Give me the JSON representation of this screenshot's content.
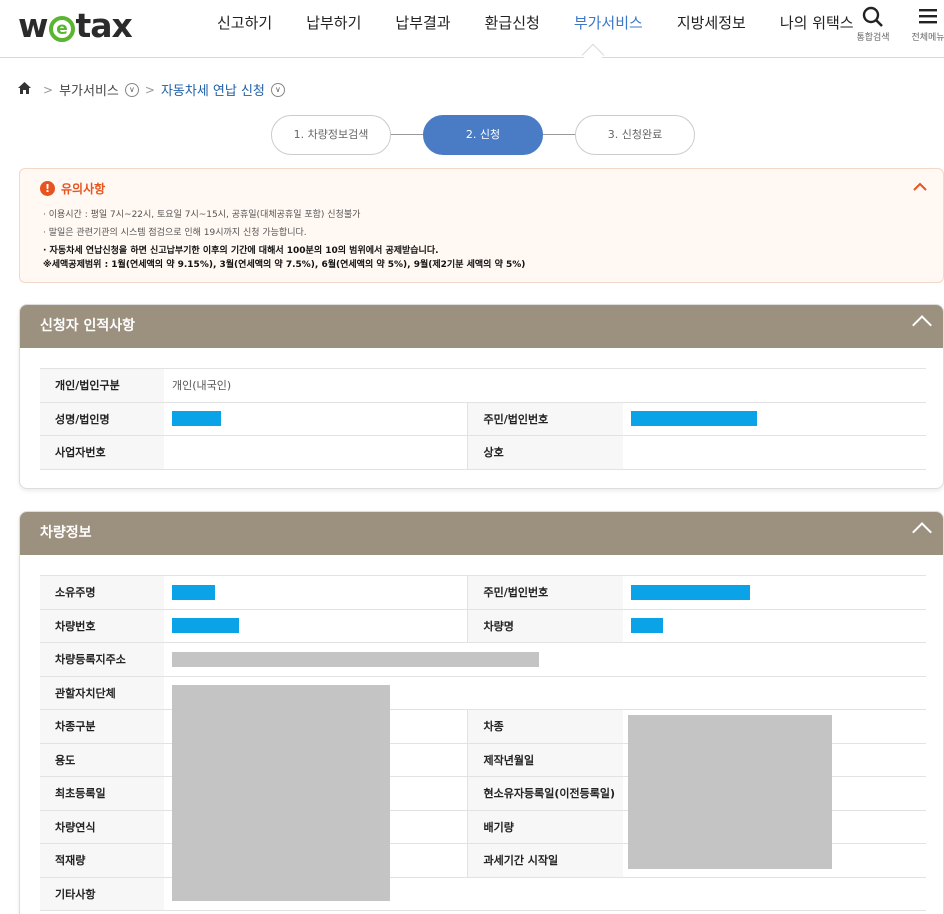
{
  "header": {
    "logo": {
      "pre": "w",
      "mid": "e",
      "post": "tax"
    },
    "nav": [
      "신고하기",
      "납부하기",
      "납부결과",
      "환급신청",
      "부가서비스",
      "지방세정보",
      "나의 위택스"
    ],
    "active_nav": "부가서비스",
    "search_label": "통합검색",
    "menu_label": "전체메뉴"
  },
  "breadcrumb": {
    "level1": "부가서비스",
    "level2": "자동차세 연납 신청"
  },
  "steps": [
    "1. 차량정보검색",
    "2. 신청",
    "3. 신청완료"
  ],
  "current_step": 2,
  "notice": {
    "title": "유의사항",
    "lines": [
      "· 이용시간 : 평일 7시~22시, 토요일 7시~15시, 공휴일(대체공휴일 포함) 신청불가",
      "· 말일은 관련기관의 시스템 점검으로 인해 19시까지 신청 가능합니다.",
      "· 자동차세 연납신청을 하면 신고납부기한 이후의 기간에 대해서 100분의 10의 범위에서 공제받습니다.",
      "※세액공제범위 : 1월(연세액의 약 9.15%), 3월(연세액의 약 7.5%), 6월(연세액의 약 5%), 9월(제2기분 세액의 약 5%)"
    ]
  },
  "applicant": {
    "title": "신청자 인적사항",
    "labels": {
      "type": "개인/법인구분",
      "name": "성명/법인명",
      "reg_no": "주민/법인번호",
      "biz_no": "사업자번호",
      "trade_name": "상호"
    },
    "type_value": "개인(내국인)"
  },
  "vehicle": {
    "title": "차량정보",
    "labels": {
      "owner": "소유주명",
      "reg_no": "주민/법인번호",
      "plate": "차량번호",
      "model": "차량명",
      "address": "차량등록지주소",
      "authority": "관할자치단체",
      "category": "차종구분",
      "kind": "차종",
      "usage": "용도",
      "made": "제작년월일",
      "first_reg": "최초등록일",
      "owner_reg": "현소유자등록일(이전등록일)",
      "year": "차량연식",
      "displacement": "배기량",
      "load": "적재량",
      "tax_start": "과세기간 시작일",
      "etc": "기타사항"
    }
  },
  "colors": {
    "brand_green": "#5bb531",
    "active_blue": "#3c78c8",
    "warning_orange": "#e8541e",
    "panel_header": "#9c907f",
    "mask_blue": "#0aa3e8"
  }
}
